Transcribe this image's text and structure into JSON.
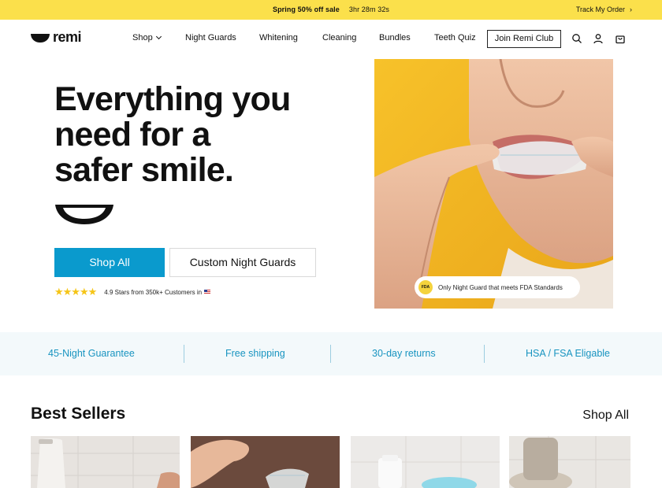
{
  "announcement": {
    "promo_label": "Spring 50% off sale",
    "timer": "3hr 28m 32s",
    "track_order": "Track My Order",
    "track_chevron": "›"
  },
  "header": {
    "logo_text": "remi",
    "nav": [
      {
        "label": "Shop",
        "has_dropdown": true
      },
      {
        "label": "Night Guards"
      },
      {
        "label": "Whitening"
      },
      {
        "label": "Cleaning"
      },
      {
        "label": "Bundles"
      },
      {
        "label": "Teeth Quiz"
      }
    ],
    "club_button": "Join Remi Club",
    "icons": [
      "search-icon",
      "account-icon",
      "cart-icon"
    ]
  },
  "hero": {
    "headline": [
      "Everything you",
      "need for a",
      "safer smile."
    ],
    "primary_cta": "Shop All",
    "secondary_cta": "Custom Night Guards",
    "stars": "★★★★★",
    "rating_value": 4.9,
    "rating_text": "4.9 Stars from 350k+ Customers in",
    "fda_badge": "FDA",
    "fda_text": "Only Night Guard that meets FDA Standards"
  },
  "benefits": [
    "45-Night Guarantee",
    "Free shipping",
    "30-day returns",
    "HSA / FSA Eligable"
  ],
  "best_sellers": {
    "title": "Best Sellers",
    "shop_all": "Shop All",
    "product_count_visible": 4
  },
  "colors": {
    "announcement_bg": "#fbe04b",
    "primary": "#0a9acd",
    "benefit_text": "#1894c0",
    "benefit_bg": "#f3f9fb",
    "star": "#f5c518"
  }
}
